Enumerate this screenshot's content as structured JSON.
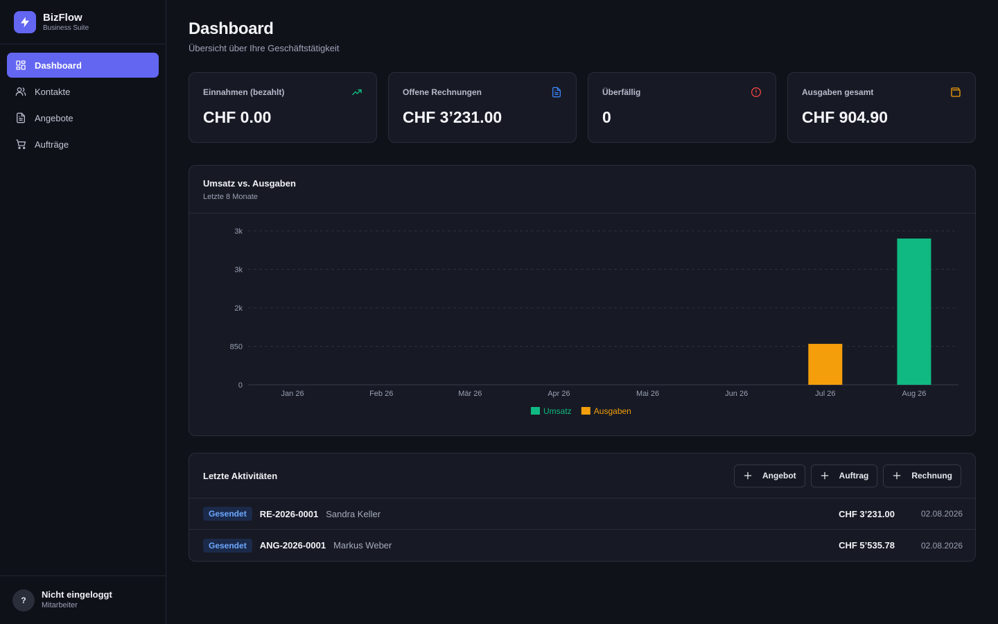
{
  "brand": {
    "name": "BizFlow",
    "subtitle": "Business Suite"
  },
  "sidebar": {
    "items": [
      {
        "label": "Dashboard",
        "icon": "grid-icon",
        "active": true
      },
      {
        "label": "Kontakte",
        "icon": "users-icon"
      },
      {
        "label": "Angebote",
        "icon": "document-icon"
      },
      {
        "label": "Aufträge",
        "icon": "cart-icon"
      }
    ]
  },
  "user": {
    "initial": "?",
    "name": "Nicht eingeloggt",
    "role": "Mitarbeiter"
  },
  "header": {
    "title": "Dashboard",
    "subtitle": "Übersicht über Ihre Geschäftstätigkeit"
  },
  "stats": [
    {
      "label": "Einnahmen (bezahlt)",
      "value": "CHF 0.00",
      "icon": "trending-up-icon",
      "color": "#10b981"
    },
    {
      "label": "Offene Rechnungen",
      "value": "CHF 3’231.00",
      "icon": "file-text-icon",
      "color": "#3b82f6"
    },
    {
      "label": "Überfällig",
      "value": "0",
      "icon": "alert-circle-icon",
      "color": "#ef4444"
    },
    {
      "label": "Ausgaben gesamt",
      "value": "CHF 904.90",
      "icon": "wallet-icon",
      "color": "#f59e0b"
    }
  ],
  "chart": {
    "title": "Umsatz vs. Ausgaben",
    "subtitle": "Letzte 8 Monate"
  },
  "chart_data": {
    "type": "bar",
    "categories": [
      "Jan 26",
      "Feb 26",
      "Mär 26",
      "Apr 26",
      "Mai 26",
      "Jun 26",
      "Jul 26",
      "Aug 26"
    ],
    "series": [
      {
        "name": "Umsatz",
        "color": "#10b981",
        "values": [
          0,
          0,
          0,
          0,
          0,
          0,
          0,
          3231
        ]
      },
      {
        "name": "Ausgaben",
        "color": "#f59e0b",
        "values": [
          0,
          0,
          0,
          0,
          0,
          0,
          904.9,
          0
        ]
      }
    ],
    "yticks": [
      0,
      850,
      1700,
      2550,
      3400
    ],
    "ytick_labels": [
      "0",
      "850",
      "2k",
      "3k",
      "3k"
    ],
    "ylim": [
      0,
      3400
    ],
    "grid": true,
    "legend": "bottom-center"
  },
  "activities": {
    "title": "Letzte Aktivitäten",
    "buttons": [
      "Angebot",
      "Auftrag",
      "Rechnung"
    ],
    "rows": [
      {
        "status": "Gesendet",
        "number": "RE-2026-0001",
        "contact": "Sandra Keller",
        "amount": "CHF 3’231.00",
        "date": "02.08.2026"
      },
      {
        "status": "Gesendet",
        "number": "ANG-2026-0001",
        "contact": "Markus Weber",
        "amount": "CHF 5’535.78",
        "date": "02.08.2026"
      }
    ]
  }
}
